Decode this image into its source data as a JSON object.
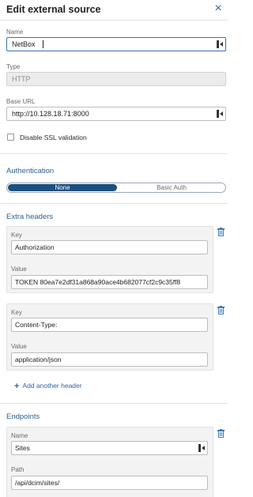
{
  "dialog": {
    "title": "Edit external source",
    "close_icon": "×"
  },
  "form": {
    "name": {
      "label": "Name",
      "value": "NetBox"
    },
    "type": {
      "label": "Type",
      "value": "HTTP"
    },
    "base_url": {
      "label": "Base URL",
      "value": "http://10.128.18.71:8000"
    },
    "disable_ssl": {
      "label": "Disable SSL validation",
      "checked": false
    }
  },
  "authentication": {
    "title": "Authentication",
    "options": [
      "None",
      "Basic Auth"
    ],
    "selected": "None"
  },
  "extra_headers": {
    "title": "Extra headers",
    "key_label": "Key",
    "value_label": "Value",
    "items": [
      {
        "key": "Authorization",
        "value": "TOKEN 80ea7e2df31a868a90ace4b682077cf2c9c35ff8"
      },
      {
        "key": "Content-Type:",
        "value": "application/json"
      }
    ],
    "add_label": "Add another header"
  },
  "endpoints": {
    "title": "Endpoints",
    "name_label": "Name",
    "path_label": "Path",
    "items": [
      {
        "name": "Sites",
        "path": "/api/dcim/sites/"
      }
    ]
  },
  "colors": {
    "accent": "#2c5f8f",
    "toggle_active": "#1d4f7f",
    "link": "#2c67a4"
  }
}
